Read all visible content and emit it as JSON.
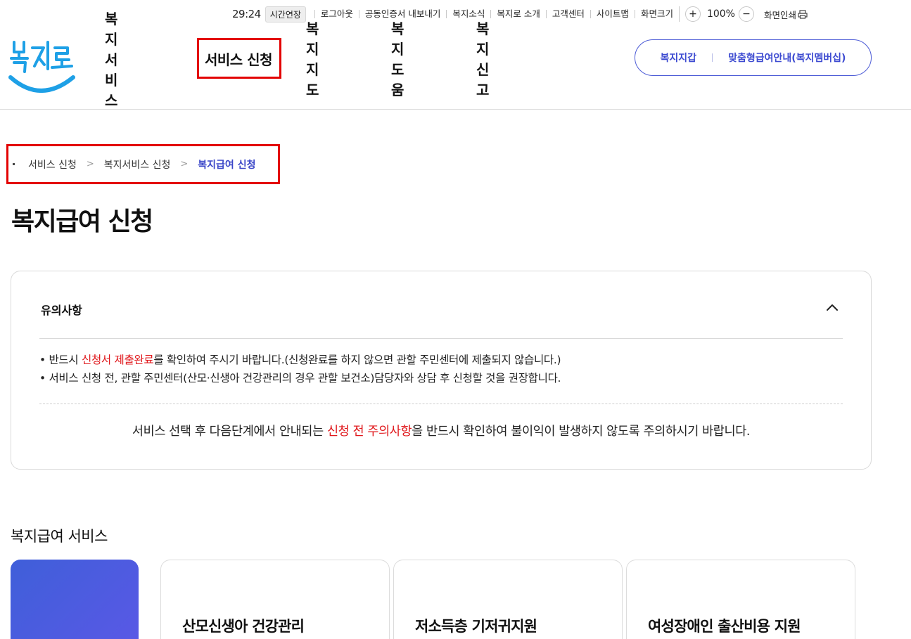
{
  "utility": {
    "timer": "29:24",
    "extend_label": "시간연장",
    "links": [
      "로그아웃",
      "공동인증서 내보내기",
      "복지소식",
      "복지로 소개",
      "고객센터",
      "사이트맵"
    ],
    "font_size_label": "화면크기",
    "zoom_in": "+",
    "zoom_value": "100%",
    "zoom_out": "−",
    "print_label": "화면인쇄"
  },
  "logo": {
    "alt_text": "복지로",
    "color": "#1ea0e6"
  },
  "gnb": {
    "items": [
      "복지서비스",
      "서비스 신청",
      "복지지도",
      "복지도움",
      "복지신고"
    ]
  },
  "member_box": {
    "wallet": "복지지갑",
    "membership": "맞춤형급여안내(복지멤버십)"
  },
  "breadcrumb": {
    "items": [
      "서비스 신청",
      "복지서비스 신청"
    ],
    "current": "복지급여 신청",
    "separator": ">"
  },
  "page_title": "복지급여 신청",
  "notice": {
    "heading": "유의사항",
    "line1_prefix": "• 반드시 ",
    "line1_highlight": "신청서 제출완료",
    "line1_suffix": "를 확인하여 주시기 바랍니다.(신청완료를 하지 않으면 관할 주민센터에 제출되지 않습니다.)",
    "line2": "• 서비스 신청 전, 관할 주민센터(산모·신생아 건강관리의 경우 관할 보건소)담당자와 상담 후 신청할 것을 권장합니다.",
    "bottom_prefix": "서비스 선택 후 다음단계에서 안내되는 ",
    "bottom_highlight": "신청 전 주의사항",
    "bottom_suffix": "을 반드시 확인하여 불이익이 발생하지 않도록 주의하시기 바랍니다."
  },
  "services": {
    "title": "복지급여 서비스",
    "cards": [
      "산모신생아 건강관리",
      "저소득층 기저귀지원",
      "여성장애인 출산비용 지원"
    ]
  },
  "colors": {
    "accent": "#3d4bd1",
    "highlight_red": "#e0181c",
    "annotation_red": "#e30000"
  }
}
